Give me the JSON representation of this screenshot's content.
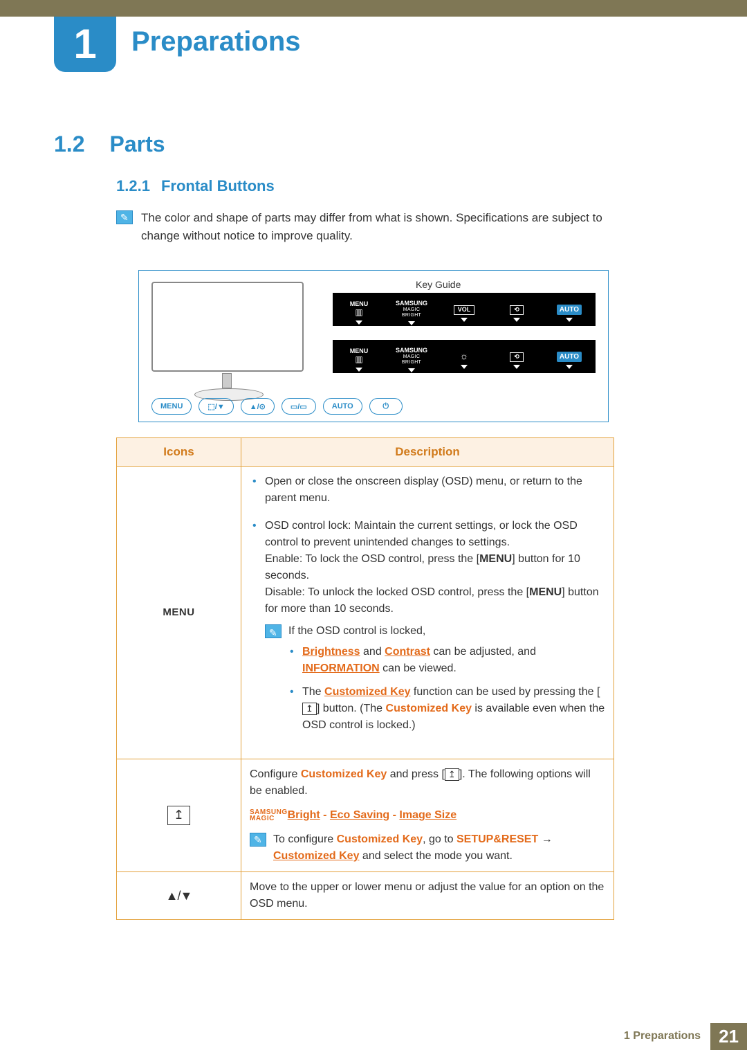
{
  "chapter": {
    "number": "1",
    "title": "Preparations"
  },
  "section": {
    "number": "1.2",
    "title": "Parts"
  },
  "subsection": {
    "number": "1.2.1",
    "title": "Frontal Buttons"
  },
  "intro_note": "The color and shape of parts may differ from what is shown. Specifications are subject to change without notice to improve quality.",
  "diagram": {
    "key_guide": "Key Guide",
    "osd_rows": [
      {
        "cells": [
          "MENU",
          "SAMSUNG MAGIC BRIGHT",
          "VOL",
          "⟲",
          "AUTO"
        ]
      },
      {
        "cells": [
          "MENU",
          "SAMSUNG MAGIC BRIGHT",
          "☼",
          "⟲",
          "AUTO"
        ]
      }
    ],
    "buttons": [
      "MENU",
      "⬚/▼",
      "▲/⊙",
      "▭/▭",
      "AUTO",
      "⏻"
    ]
  },
  "table": {
    "headers": {
      "icons": "Icons",
      "description": "Description"
    },
    "rows": {
      "menu": {
        "icon_label": "MENU",
        "desc_open": "Open or close the onscreen display (OSD) menu, or return to the parent menu.",
        "desc_lock_intro": "OSD control lock: Maintain the current settings, or lock the OSD control to prevent unintended changes to settings.",
        "desc_enable_pre": "Enable: To lock the OSD control, press the [",
        "desc_enable_btn": "MENU",
        "desc_enable_post": "] button for 10 seconds.",
        "desc_disable_pre": "Disable: To unlock the locked OSD control, press the [",
        "desc_disable_btn": "MENU",
        "desc_disable_post": "] button for more than 10 seconds.",
        "note_locked": "If the OSD control is locked,",
        "sub_bc_1": "Brightness",
        "sub_bc_and": " and ",
        "sub_bc_2": "Contrast",
        "sub_bc_post": " can be adjusted, and ",
        "sub_bc_info": "INFORMATION",
        "sub_bc_end": " can be viewed.",
        "sub_ck_pre": "The ",
        "sub_ck_name": "Customized Key",
        "sub_ck_mid": " function can be used by pressing the [",
        "sub_ck_post1": "] button. (The ",
        "sub_ck_name2": "Customized Key",
        "sub_ck_end": " is available even when the OSD control is locked.)"
      },
      "custom": {
        "cfg_pre": "Configure ",
        "cfg_name": "Customized Key",
        "cfg_mid": " and press [",
        "cfg_post": "]. The following options will be enabled.",
        "opt_magic_1": "SAMSUNG",
        "opt_magic_2": "MAGIC",
        "opt_bright": "Bright",
        "opt_sep": " - ",
        "opt_eco": "Eco Saving",
        "opt_size": "Image Size",
        "note_pre": "To configure ",
        "note_ck": "Customized Key",
        "note_mid": ", go to ",
        "note_setup": "SETUP&RESET",
        "note_arrow": "  →  ",
        "note_ck2": "Customized Key",
        "note_end": " and select the mode you want."
      },
      "updown": {
        "desc": "Move to the upper or lower menu or adjust the value for an option on the OSD menu."
      }
    }
  },
  "footer": {
    "label": "1 Preparations",
    "page": "21"
  }
}
